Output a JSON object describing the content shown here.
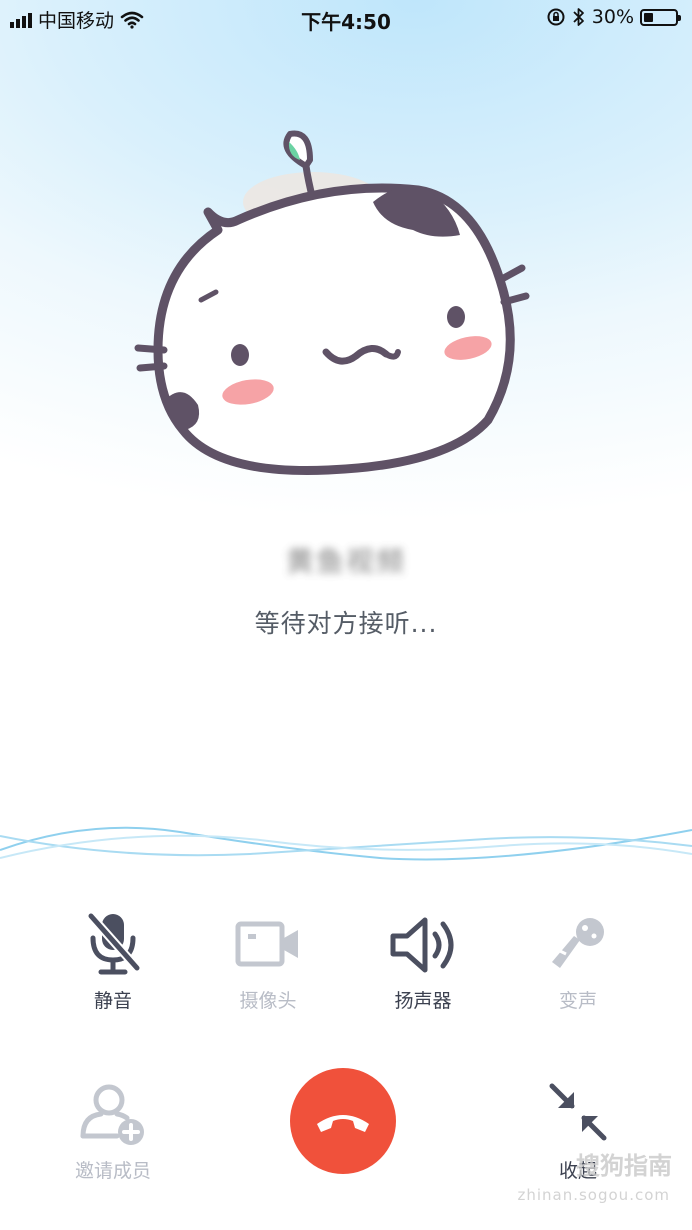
{
  "status_bar": {
    "carrier": "中国移动",
    "time": "下午4:50",
    "battery_percent": "30%",
    "battery_level": 0.3
  },
  "call": {
    "caller_name": "黄鱼视频",
    "status": "等待对方接听..."
  },
  "controls": {
    "mute": "静音",
    "camera": "摄像头",
    "speaker": "扬声器",
    "voice_change": "变声",
    "invite": "邀请成员",
    "minimize": "收起"
  },
  "watermark": {
    "text": "搜狗指南",
    "url": "zhinan.sogou.com"
  },
  "colors": {
    "hangup": "#f0513b",
    "active_icon": "#4b4f60",
    "inactive_icon": "#c3c7cf"
  }
}
